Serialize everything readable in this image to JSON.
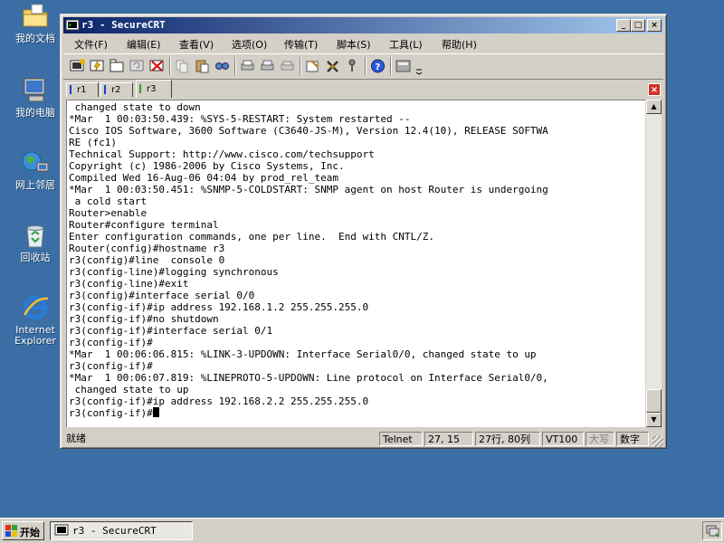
{
  "desktop": {
    "icons": [
      {
        "label": "我的文档",
        "icon": "my-documents-folder-icon"
      },
      {
        "label": "我的电脑",
        "icon": "my-computer-icon"
      },
      {
        "label": "网上邻居",
        "icon": "network-places-icon"
      },
      {
        "label": "回收站",
        "icon": "recycle-bin-icon"
      },
      {
        "label": "Internet\nExplorer",
        "icon": "internet-explorer-icon"
      }
    ]
  },
  "window": {
    "title": "r3 - SecureCRT",
    "controls": {
      "minimize": "_",
      "maximize": "□",
      "close": "×"
    }
  },
  "menubar": {
    "items": [
      "文件(F)",
      "编辑(E)",
      "查看(V)",
      "选项(O)",
      "传输(T)",
      "脚本(S)",
      "工具(L)",
      "帮助(H)"
    ]
  },
  "toolbar": {
    "icons": [
      "connect-icon",
      "quick-connect-icon",
      "connect-in-tab-icon",
      "reconnect-icon",
      "disconnect-icon",
      "copy-icon",
      "paste-icon",
      "find-icon",
      "print-icon",
      "print-selection-icon",
      "print-setup-icon",
      "session-options-icon",
      "global-options-icon",
      "keymap-icon",
      "help-icon",
      "sftp-icon"
    ]
  },
  "tabs": [
    {
      "label": "r1",
      "active": false,
      "status_color": "#1a3fd0"
    },
    {
      "label": "r2",
      "active": false,
      "status_color": "#1a3fd0"
    },
    {
      "label": "r3",
      "active": true,
      "status_color": "#2ca02c"
    }
  ],
  "terminal": {
    "lines": [
      " changed state to down",
      "*Mar  1 00:03:50.439: %SYS-5-RESTART: System restarted --",
      "Cisco IOS Software, 3600 Software (C3640-JS-M), Version 12.4(10), RELEASE SOFTWA",
      "RE (fc1)",
      "Technical Support: http://www.cisco.com/techsupport",
      "Copyright (c) 1986-2006 by Cisco Systems, Inc.",
      "Compiled Wed 16-Aug-06 04:04 by prod_rel_team",
      "*Mar  1 00:03:50.451: %SNMP-5-COLDSTART: SNMP agent on host Router is undergoing",
      " a cold start",
      "Router>enable",
      "Router#configure terminal",
      "Enter configuration commands, one per line.  End with CNTL/Z.",
      "Router(config)#hostname r3",
      "r3(config)#line  console 0",
      "r3(config-line)#logging synchronous",
      "r3(config-line)#exit",
      "r3(config)#interface serial 0/0",
      "r3(config-if)#ip address 192.168.1.2 255.255.255.0",
      "r3(config-if)#no shutdown",
      "r3(config-if)#interface serial 0/1",
      "r3(config-if)#",
      "*Mar  1 00:06:06.815: %LINK-3-UPDOWN: Interface Serial0/0, changed state to up",
      "r3(config-if)#",
      "*Mar  1 00:06:07.819: %LINEPROTO-5-UPDOWN: Line protocol on Interface Serial0/0,",
      " changed state to up",
      "r3(config-if)#ip address 192.168.2.2 255.255.255.0"
    ],
    "prompt": "r3(config-if)#"
  },
  "statusbar": {
    "ready": "就绪",
    "protocol": "Telnet",
    "position": "27,  15",
    "rowcol": "27行, 80列",
    "emulation": "VT100",
    "caps": "大写",
    "num": "数字"
  },
  "taskbar": {
    "start": "开始",
    "task": "r3 - SecureCRT"
  }
}
